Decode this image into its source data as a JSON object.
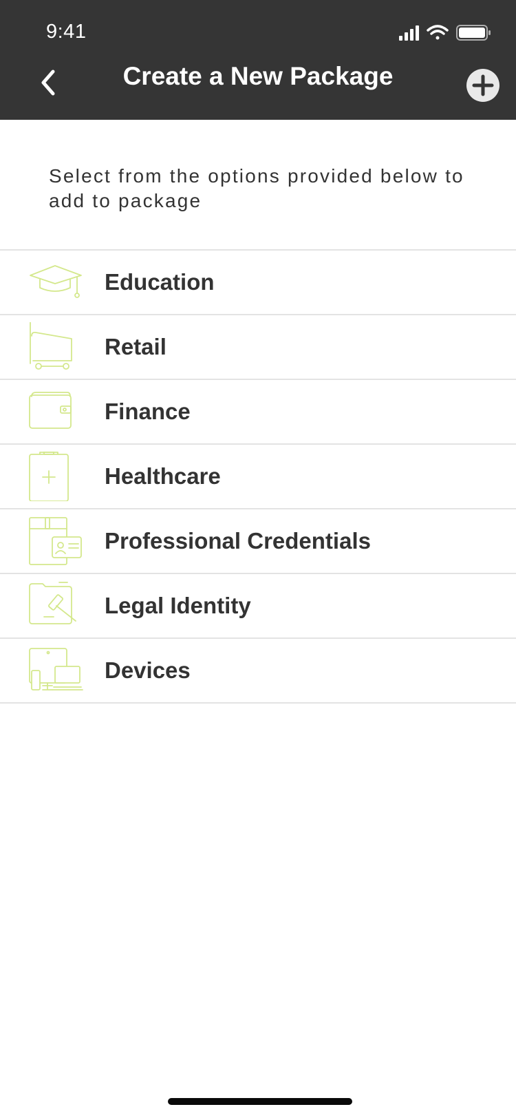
{
  "status_bar": {
    "time": "9:41"
  },
  "header": {
    "title": "Create a New Package",
    "back_icon": "chevron-left-icon",
    "add_icon": "plus-circle-icon"
  },
  "intro": {
    "text": "Select from the options provided below to add to package"
  },
  "categories": [
    {
      "label": "Education",
      "icon": "graduation-cap-icon"
    },
    {
      "label": "Retail",
      "icon": "shopping-cart-icon"
    },
    {
      "label": "Finance",
      "icon": "wallet-icon"
    },
    {
      "label": "Healthcare",
      "icon": "medical-clipboard-icon"
    },
    {
      "label": "Professional Credentials",
      "icon": "id-card-folder-icon"
    },
    {
      "label": "Legal Identity",
      "icon": "gavel-folder-icon"
    },
    {
      "label": "Devices",
      "icon": "devices-icon"
    }
  ],
  "colors": {
    "header_bg": "#353535",
    "icon_accent": "#d4e88c",
    "divider": "#e3e3e3",
    "text": "#333333"
  }
}
